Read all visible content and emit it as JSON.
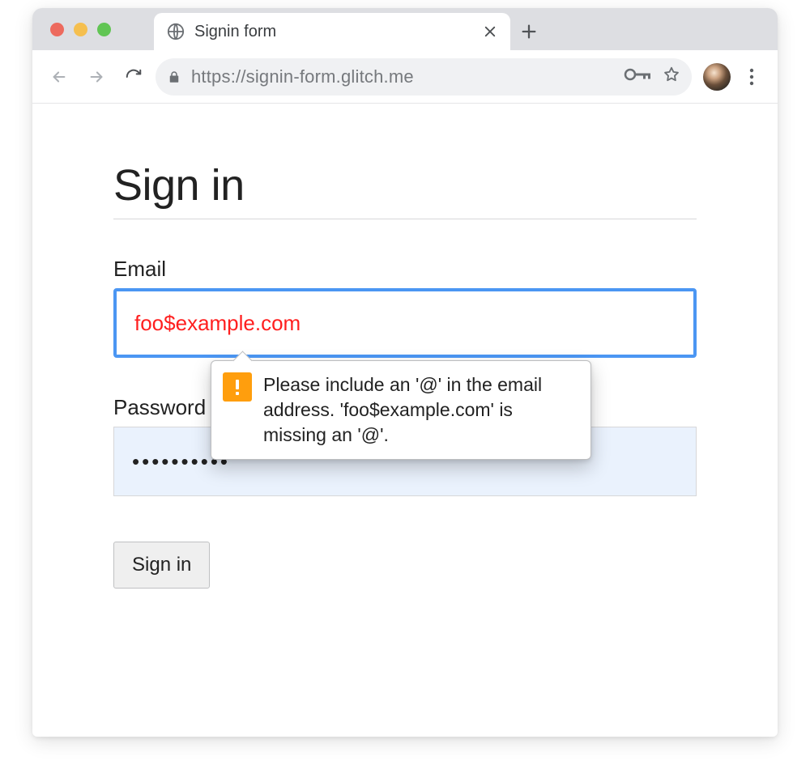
{
  "window": {
    "tab_title": "Signin form",
    "url": "https://signin-form.glitch.me"
  },
  "page": {
    "heading": "Sign in",
    "email_label": "Email",
    "email_value": "foo$example.com",
    "password_label": "Password",
    "password_value": "••••••••••",
    "submit_label": "Sign in"
  },
  "validation": {
    "message": "Please include an '@' in the email address. 'foo$example.com' is missing an '@'."
  }
}
